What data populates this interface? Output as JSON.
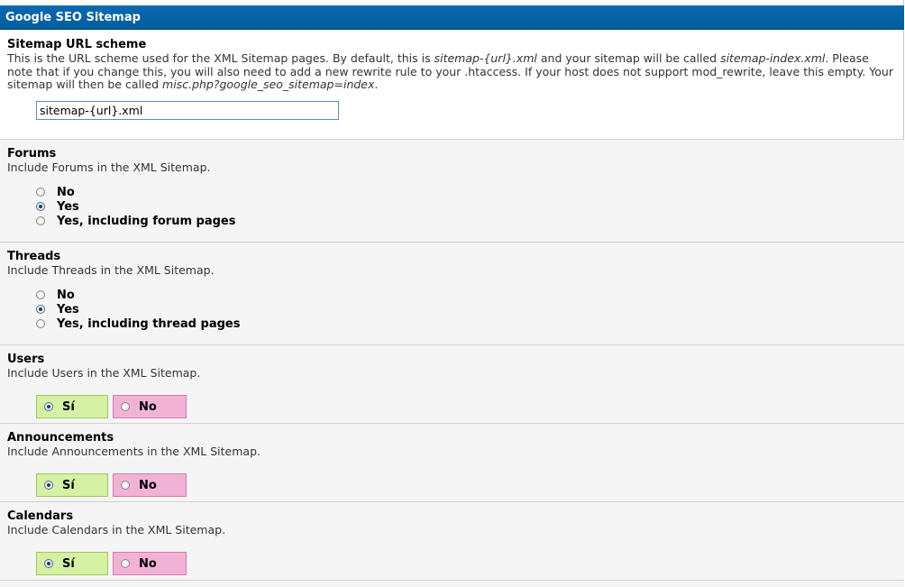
{
  "header": {
    "title": "Google SEO Sitemap"
  },
  "sitemap_url": {
    "title": "Sitemap URL scheme",
    "desc_1": "This is the URL scheme used for the XML Sitemap pages. By default, this is ",
    "desc_em_1": "sitemap-{url}.xml",
    "desc_2": " and your sitemap will be called ",
    "desc_em_2": "sitemap-index.xml",
    "desc_3": ". Please note that if you change this, you will also need to add a new rewrite rule to your .htaccess. If your host does not support mod_rewrite, leave this empty. Your sitemap will then be called ",
    "desc_em_3": "misc.php?google_seo_sitemap=index",
    "desc_4": ".",
    "value": "sitemap-{url}.xml"
  },
  "forums": {
    "title": "Forums",
    "desc": "Include Forums in the XML Sitemap.",
    "options": [
      "No",
      "Yes",
      "Yes, including forum pages"
    ],
    "selected": "Yes"
  },
  "threads": {
    "title": "Threads",
    "desc": "Include Threads in the XML Sitemap.",
    "options": [
      "No",
      "Yes",
      "Yes, including thread pages"
    ],
    "selected": "Yes"
  },
  "users": {
    "title": "Users",
    "desc": "Include Users in the XML Sitemap.",
    "yes_label": "Sí",
    "no_label": "No",
    "selected": "Sí"
  },
  "announcements": {
    "title": "Announcements",
    "desc": "Include Announcements in the XML Sitemap.",
    "yes_label": "Sí",
    "no_label": "No",
    "selected": "Sí"
  },
  "calendars": {
    "title": "Calendars",
    "desc": "Include Calendars in the XML Sitemap.",
    "yes_label": "Sí",
    "no_label": "No",
    "selected": "Sí"
  },
  "colors": {
    "header_bg": "#0a64a8",
    "yes_bg": "#d6f0a4",
    "no_bg": "#f2b2d6",
    "row_alt_bg": "#f5f5f5"
  }
}
